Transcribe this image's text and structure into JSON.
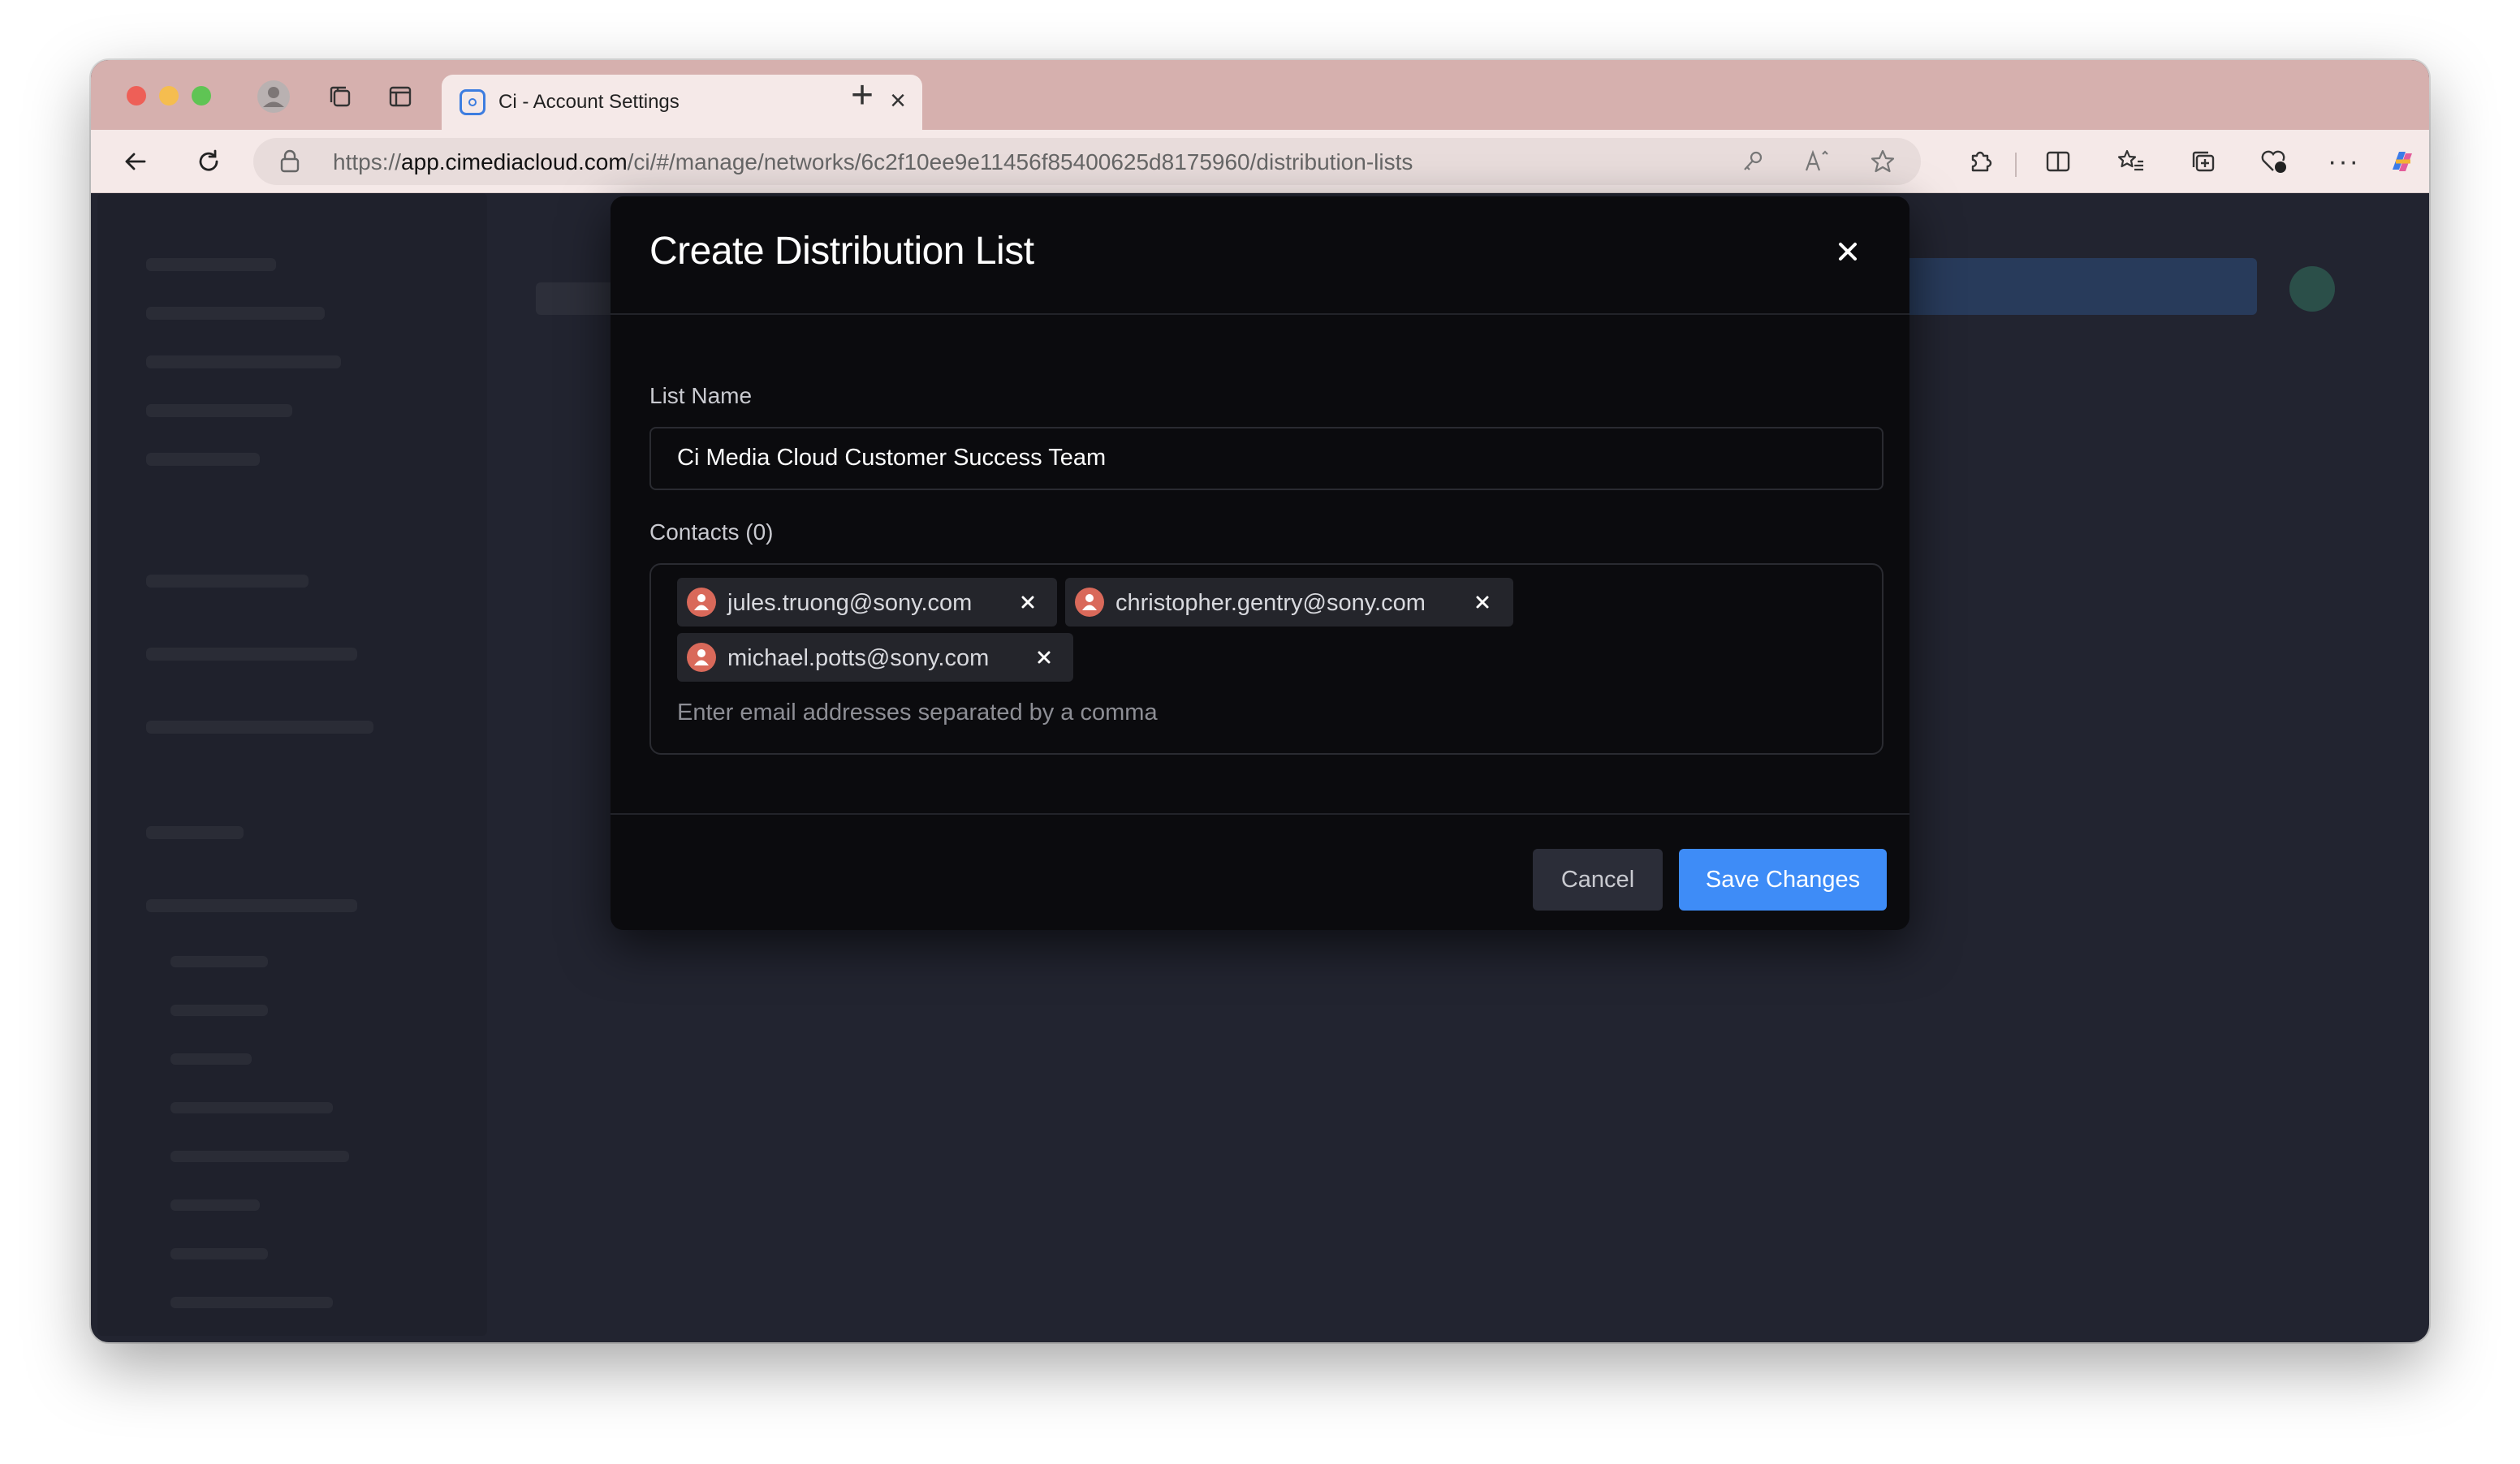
{
  "browser": {
    "tab_title": "Ci - Account Settings",
    "url_scheme": "https://",
    "url_host": "app.cimediacloud.com",
    "url_path": "/ci/#/manage/networks/6c2f10ee9e11456f85400625d8175960/distribution-lists",
    "icons": [
      "profile-icon",
      "workspaces-icon",
      "tab-actions-icon",
      "favicon",
      "close-icon",
      "new-tab-icon",
      "back-icon",
      "refresh-icon",
      "lock-icon",
      "key-icon",
      "read-aloud-icon",
      "favorite-icon",
      "extensions-icon",
      "split-screen-icon",
      "favorites-icon",
      "collections-icon",
      "performance-icon",
      "more-icon",
      "copilot-icon"
    ]
  },
  "modal": {
    "title": "Create Distribution List",
    "list_name_label": "List Name",
    "list_name_value": "Ci Media Cloud Customer Success Team",
    "contacts_label": "Contacts (0)",
    "contacts": [
      {
        "email": "jules.truong@sony.com"
      },
      {
        "email": "christopher.gentry@sony.com"
      },
      {
        "email": "michael.potts@sony.com"
      }
    ],
    "contacts_placeholder": "Enter email addresses separated by a comma",
    "cancel_label": "Cancel",
    "save_label": "Save Changes"
  },
  "colors": {
    "accent": "#3e8cf7",
    "avatar": "#d9695a",
    "modal_bg": "#0b0b0e",
    "backdrop": "#222430",
    "tabstrip": "#d6b0ae"
  }
}
